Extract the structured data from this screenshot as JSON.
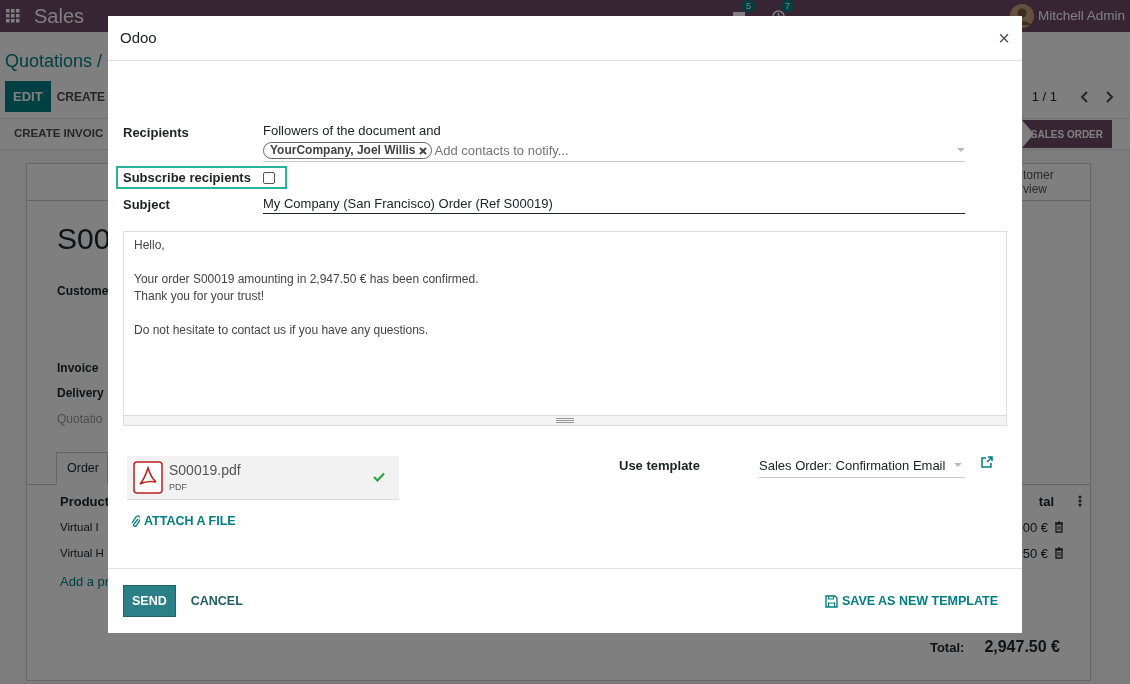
{
  "navbar": {
    "app": "Sales",
    "messages_count": "5",
    "activities_count": "7",
    "user": "Mitchell Admin"
  },
  "breadcrumb": "Quotations /",
  "actions": [
    {
      "label": "EDIT",
      "kind": "primary"
    },
    {
      "label": "CREATE",
      "kind": "secondary"
    }
  ],
  "pager": "1 / 1",
  "status_actions": [
    "CREATE INVOIC"
  ],
  "stages": [
    {
      "label": "SALES ORDER",
      "selected": true
    }
  ],
  "sheet": {
    "smart_button": "tomer view",
    "title": "S00",
    "fields": [
      {
        "label": "Custome",
        "kind": "label"
      },
      {
        "label": "Invoice",
        "kind": "label"
      },
      {
        "label": "Delivery",
        "kind": "label"
      },
      {
        "label": "Quotatio",
        "kind": "muted"
      }
    ],
    "tabs": [
      {
        "label": "Order",
        "selected": true
      }
    ],
    "columns": [
      "Product",
      "tal"
    ],
    "rows": [
      {
        "product": "Virtual I",
        "total": "00 €"
      },
      {
        "product": "Virtual H",
        "total": "50 €"
      }
    ],
    "add_line": "Add a pr",
    "total_label": "Total:",
    "total_value": "2,947.50 €"
  },
  "dialog": {
    "title": "Odoo",
    "close": "×",
    "recipients_label": "Recipients",
    "recipients_text": "Followers of the document and",
    "tags": [
      {
        "label": "YourCompany, Joel Willis"
      }
    ],
    "contacts_placeholder": "Add contacts to notify...",
    "subscribe": {
      "label": "Subscribe recipients",
      "checked": false,
      "highlighted": true
    },
    "subject_label": "Subject",
    "subject": "My Company (San Francisco) Order (Ref S00019)",
    "body_paragraphs": [
      {
        "lines": [
          "Hello,"
        ]
      },
      {
        "lines": [
          "Your order S00019 amounting in 2,947.50 € has been confirmed.",
          "Thank you for your trust!"
        ]
      },
      {
        "lines": [
          "Do not hesitate to contact us if you have any questions."
        ]
      }
    ],
    "attachments": [
      {
        "name": "S00019.pdf",
        "type": "PDF",
        "uploaded": true
      }
    ],
    "attach_label": "ATTACH A FILE",
    "template_label": "Use template",
    "template": "Sales Order: Confirmation Email",
    "buttons": [
      {
        "label": "SEND",
        "kind": "primary"
      },
      {
        "label": "CANCEL",
        "kind": "link"
      },
      {
        "label": "SAVE AS NEW TEMPLATE",
        "kind": "save"
      }
    ]
  }
}
